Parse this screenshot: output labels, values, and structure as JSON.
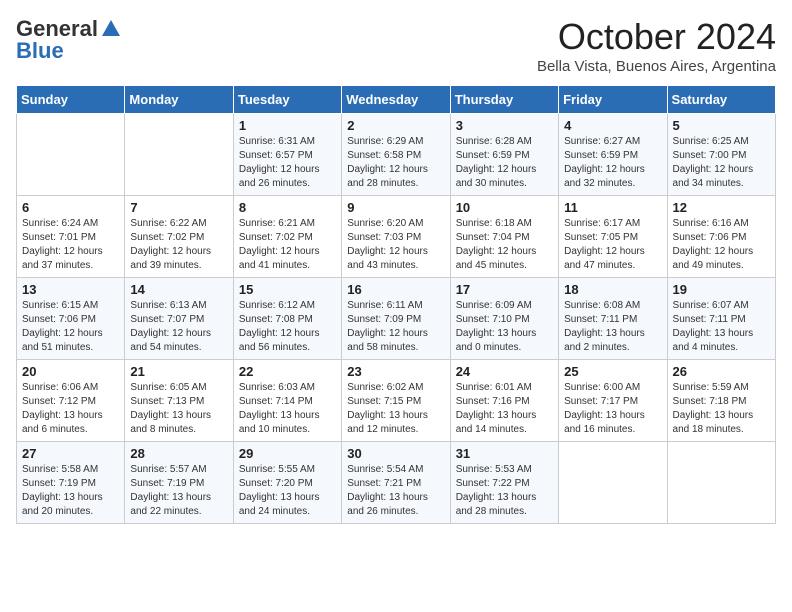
{
  "header": {
    "logo_general": "General",
    "logo_blue": "Blue",
    "title": "October 2024",
    "location": "Bella Vista, Buenos Aires, Argentina"
  },
  "days_of_week": [
    "Sunday",
    "Monday",
    "Tuesday",
    "Wednesday",
    "Thursday",
    "Friday",
    "Saturday"
  ],
  "weeks": [
    [
      {
        "day": "",
        "info": ""
      },
      {
        "day": "",
        "info": ""
      },
      {
        "day": "1",
        "sunrise": "6:31 AM",
        "sunset": "6:57 PM",
        "daylight": "12 hours and 26 minutes."
      },
      {
        "day": "2",
        "sunrise": "6:29 AM",
        "sunset": "6:58 PM",
        "daylight": "12 hours and 28 minutes."
      },
      {
        "day": "3",
        "sunrise": "6:28 AM",
        "sunset": "6:59 PM",
        "daylight": "12 hours and 30 minutes."
      },
      {
        "day": "4",
        "sunrise": "6:27 AM",
        "sunset": "6:59 PM",
        "daylight": "12 hours and 32 minutes."
      },
      {
        "day": "5",
        "sunrise": "6:25 AM",
        "sunset": "7:00 PM",
        "daylight": "12 hours and 34 minutes."
      }
    ],
    [
      {
        "day": "6",
        "sunrise": "6:24 AM",
        "sunset": "7:01 PM",
        "daylight": "12 hours and 37 minutes."
      },
      {
        "day": "7",
        "sunrise": "6:22 AM",
        "sunset": "7:02 PM",
        "daylight": "12 hours and 39 minutes."
      },
      {
        "day": "8",
        "sunrise": "6:21 AM",
        "sunset": "7:02 PM",
        "daylight": "12 hours and 41 minutes."
      },
      {
        "day": "9",
        "sunrise": "6:20 AM",
        "sunset": "7:03 PM",
        "daylight": "12 hours and 43 minutes."
      },
      {
        "day": "10",
        "sunrise": "6:18 AM",
        "sunset": "7:04 PM",
        "daylight": "12 hours and 45 minutes."
      },
      {
        "day": "11",
        "sunrise": "6:17 AM",
        "sunset": "7:05 PM",
        "daylight": "12 hours and 47 minutes."
      },
      {
        "day": "12",
        "sunrise": "6:16 AM",
        "sunset": "7:06 PM",
        "daylight": "12 hours and 49 minutes."
      }
    ],
    [
      {
        "day": "13",
        "sunrise": "6:15 AM",
        "sunset": "7:06 PM",
        "daylight": "12 hours and 51 minutes."
      },
      {
        "day": "14",
        "sunrise": "6:13 AM",
        "sunset": "7:07 PM",
        "daylight": "12 hours and 54 minutes."
      },
      {
        "day": "15",
        "sunrise": "6:12 AM",
        "sunset": "7:08 PM",
        "daylight": "12 hours and 56 minutes."
      },
      {
        "day": "16",
        "sunrise": "6:11 AM",
        "sunset": "7:09 PM",
        "daylight": "12 hours and 58 minutes."
      },
      {
        "day": "17",
        "sunrise": "6:09 AM",
        "sunset": "7:10 PM",
        "daylight": "13 hours and 0 minutes."
      },
      {
        "day": "18",
        "sunrise": "6:08 AM",
        "sunset": "7:11 PM",
        "daylight": "13 hours and 2 minutes."
      },
      {
        "day": "19",
        "sunrise": "6:07 AM",
        "sunset": "7:11 PM",
        "daylight": "13 hours and 4 minutes."
      }
    ],
    [
      {
        "day": "20",
        "sunrise": "6:06 AM",
        "sunset": "7:12 PM",
        "daylight": "13 hours and 6 minutes."
      },
      {
        "day": "21",
        "sunrise": "6:05 AM",
        "sunset": "7:13 PM",
        "daylight": "13 hours and 8 minutes."
      },
      {
        "day": "22",
        "sunrise": "6:03 AM",
        "sunset": "7:14 PM",
        "daylight": "13 hours and 10 minutes."
      },
      {
        "day": "23",
        "sunrise": "6:02 AM",
        "sunset": "7:15 PM",
        "daylight": "13 hours and 12 minutes."
      },
      {
        "day": "24",
        "sunrise": "6:01 AM",
        "sunset": "7:16 PM",
        "daylight": "13 hours and 14 minutes."
      },
      {
        "day": "25",
        "sunrise": "6:00 AM",
        "sunset": "7:17 PM",
        "daylight": "13 hours and 16 minutes."
      },
      {
        "day": "26",
        "sunrise": "5:59 AM",
        "sunset": "7:18 PM",
        "daylight": "13 hours and 18 minutes."
      }
    ],
    [
      {
        "day": "27",
        "sunrise": "5:58 AM",
        "sunset": "7:19 PM",
        "daylight": "13 hours and 20 minutes."
      },
      {
        "day": "28",
        "sunrise": "5:57 AM",
        "sunset": "7:19 PM",
        "daylight": "13 hours and 22 minutes."
      },
      {
        "day": "29",
        "sunrise": "5:55 AM",
        "sunset": "7:20 PM",
        "daylight": "13 hours and 24 minutes."
      },
      {
        "day": "30",
        "sunrise": "5:54 AM",
        "sunset": "7:21 PM",
        "daylight": "13 hours and 26 minutes."
      },
      {
        "day": "31",
        "sunrise": "5:53 AM",
        "sunset": "7:22 PM",
        "daylight": "13 hours and 28 minutes."
      },
      {
        "day": "",
        "info": ""
      },
      {
        "day": "",
        "info": ""
      }
    ]
  ]
}
